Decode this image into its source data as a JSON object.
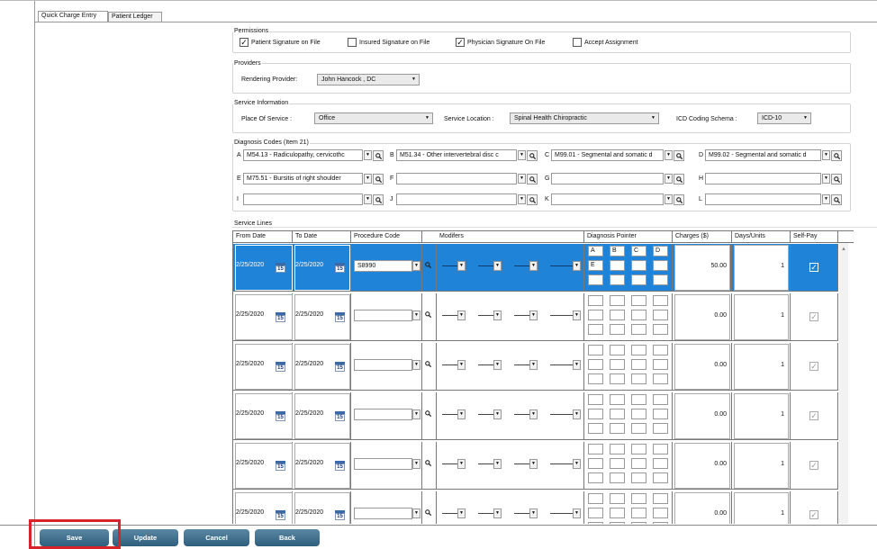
{
  "tabs": [
    {
      "label": "Quick Charge Entry"
    },
    {
      "label": "Patient Ledger"
    }
  ],
  "permissions": {
    "legend": "Permissions",
    "items": [
      {
        "label": "Patient Signature on File",
        "checked": true
      },
      {
        "label": "Insured Signature on File",
        "checked": false
      },
      {
        "label": "Physician Signature On File",
        "checked": true
      },
      {
        "label": "Accept Assignment",
        "checked": false
      }
    ]
  },
  "providers": {
    "legend": "Providers",
    "rendering_label": "Rendering Provider:",
    "rendering_value": "John  Hancock ,  DC"
  },
  "service_info": {
    "legend": "Service Information",
    "pos_label": "Place Of Service :",
    "pos_value": "Office",
    "loc_label": "Service Location :",
    "loc_value": "Spinal Health Chiropractic",
    "icd_label": "ICD Coding Schema :",
    "icd_value": "ICD-10"
  },
  "diagnosis": {
    "legend": "Diagnosis Codes (Item 21)",
    "codes": [
      {
        "letter": "A",
        "value": "M54.13 - Radiculopathy, cervicothc"
      },
      {
        "letter": "B",
        "value": "M51.34 - Other intervertebral disc c"
      },
      {
        "letter": "C",
        "value": "M99.01 - Segmental and somatic d"
      },
      {
        "letter": "D",
        "value": "M99.02 - Segmental and somatic d"
      },
      {
        "letter": "E",
        "value": "M75.51 - Bursitis of right shoulder"
      },
      {
        "letter": "F",
        "value": ""
      },
      {
        "letter": "G",
        "value": ""
      },
      {
        "letter": "H",
        "value": ""
      },
      {
        "letter": "I",
        "value": ""
      },
      {
        "letter": "J",
        "value": ""
      },
      {
        "letter": "K",
        "value": ""
      },
      {
        "letter": "L",
        "value": ""
      }
    ]
  },
  "service_lines": {
    "legend": "Service Lines",
    "headers": {
      "from": "From Date",
      "to": "To Date",
      "proc": "Procedure Code",
      "mods": "Modifers",
      "diag": "Diagnosis Pointer",
      "charges": "Charges ($)",
      "days": "Days/Units",
      "self": "Self-Pay"
    },
    "cal_icon_text": "15",
    "rows": [
      {
        "from": "2/25/2020",
        "to": "2/25/2020",
        "proc": "S8990",
        "ptrs": [
          "A",
          "B",
          "C",
          "D",
          "E",
          "",
          "",
          "",
          "",
          "",
          "",
          ""
        ],
        "charges": "50.00",
        "days": "1",
        "selfpay": true,
        "selected": true
      },
      {
        "from": "2/25/2020",
        "to": "2/25/2020",
        "proc": "",
        "ptrs": [
          "",
          "",
          "",
          "",
          "",
          "",
          "",
          "",
          "",
          "",
          "",
          ""
        ],
        "charges": "0.00",
        "days": "1",
        "selfpay": true,
        "selected": false
      },
      {
        "from": "2/25/2020",
        "to": "2/25/2020",
        "proc": "",
        "ptrs": [
          "",
          "",
          "",
          "",
          "",
          "",
          "",
          "",
          "",
          "",
          "",
          ""
        ],
        "charges": "0.00",
        "days": "1",
        "selfpay": true,
        "selected": false
      },
      {
        "from": "2/25/2020",
        "to": "2/25/2020",
        "proc": "",
        "ptrs": [
          "",
          "",
          "",
          "",
          "",
          "",
          "",
          "",
          "",
          "",
          "",
          ""
        ],
        "charges": "0.00",
        "days": "1",
        "selfpay": true,
        "selected": false
      },
      {
        "from": "2/25/2020",
        "to": "2/25/2020",
        "proc": "",
        "ptrs": [
          "",
          "",
          "",
          "",
          "",
          "",
          "",
          "",
          "",
          "",
          "",
          ""
        ],
        "charges": "0.00",
        "days": "1",
        "selfpay": true,
        "selected": false
      },
      {
        "from": "2/25/2020",
        "to": "2/25/2020",
        "proc": "",
        "ptrs": [
          "",
          "",
          "",
          "",
          "",
          "",
          "",
          "",
          "",
          "",
          "",
          ""
        ],
        "charges": "0.00",
        "days": "1",
        "selfpay": true,
        "selected": false
      }
    ]
  },
  "buttons": {
    "save": "Save",
    "update": "Update",
    "cancel": "Cancel",
    "back": "Back"
  },
  "colors": {
    "selected_row": "#1f84d8",
    "button": "#2f5f7e",
    "highlight_box": "#d9232a"
  }
}
